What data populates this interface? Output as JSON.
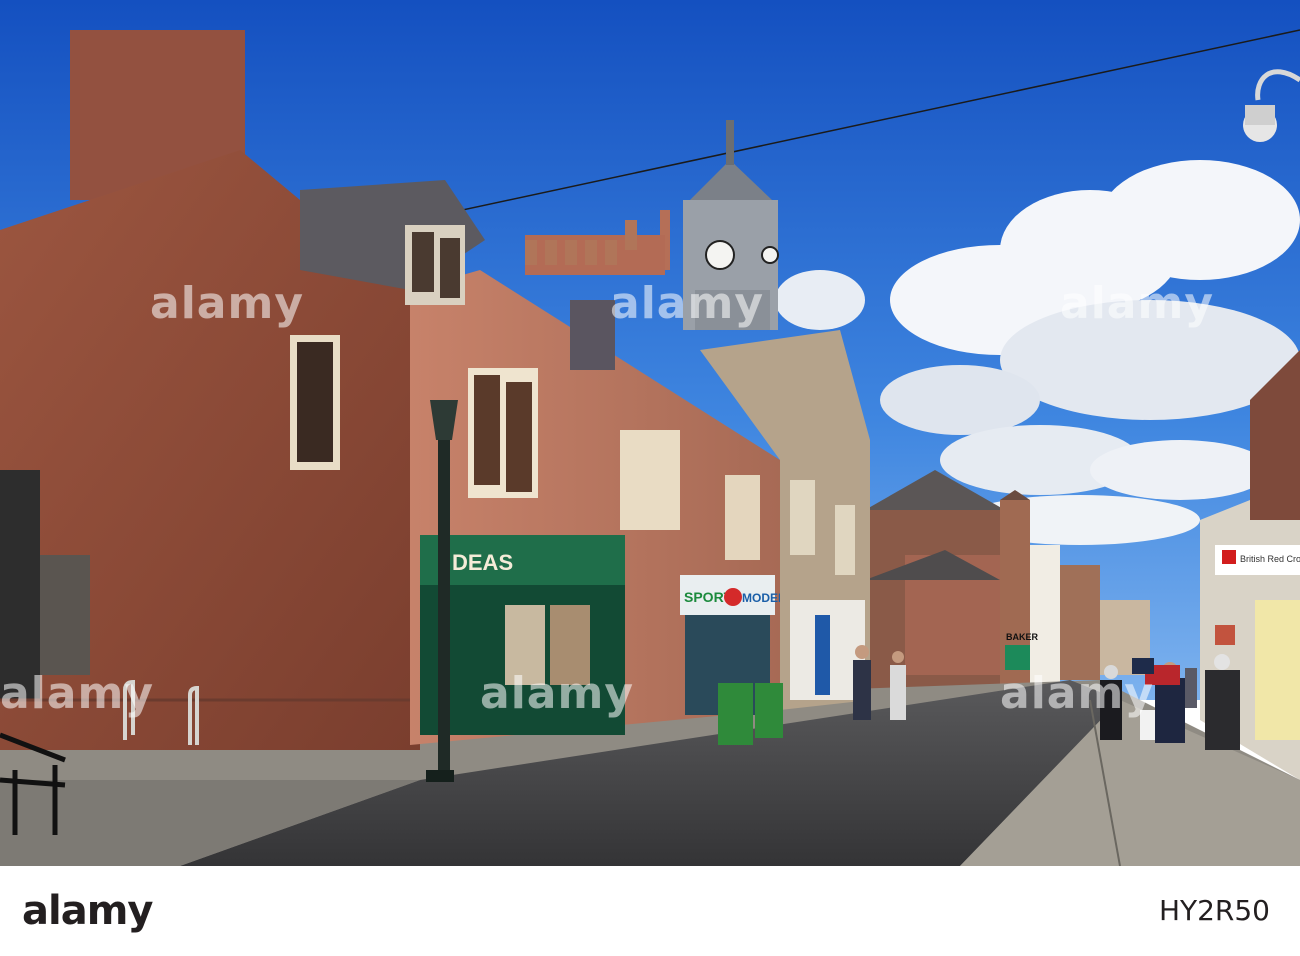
{
  "photo": {
    "alt": "",
    "signs": {
      "deas": "DEAS",
      "sports": "SPORT",
      "model": "MODEL",
      "baker": "BAKER",
      "red_cross": "British Red Cross"
    }
  },
  "watermarks": [
    "alamy",
    "alamy",
    "alamy",
    "alamy",
    "alamy",
    "alamy"
  ],
  "footer": {
    "brand": "alamy",
    "image_id": "HY2R50",
    "meta": ""
  },
  "colors": {
    "sky_top": "#1b5fc7",
    "sky_bottom": "#5e9be6",
    "sandstone": "#a55a42",
    "shopfront_green": "#1f6e4a",
    "road": "#4b4b4d",
    "pavement": "#9a958c"
  }
}
